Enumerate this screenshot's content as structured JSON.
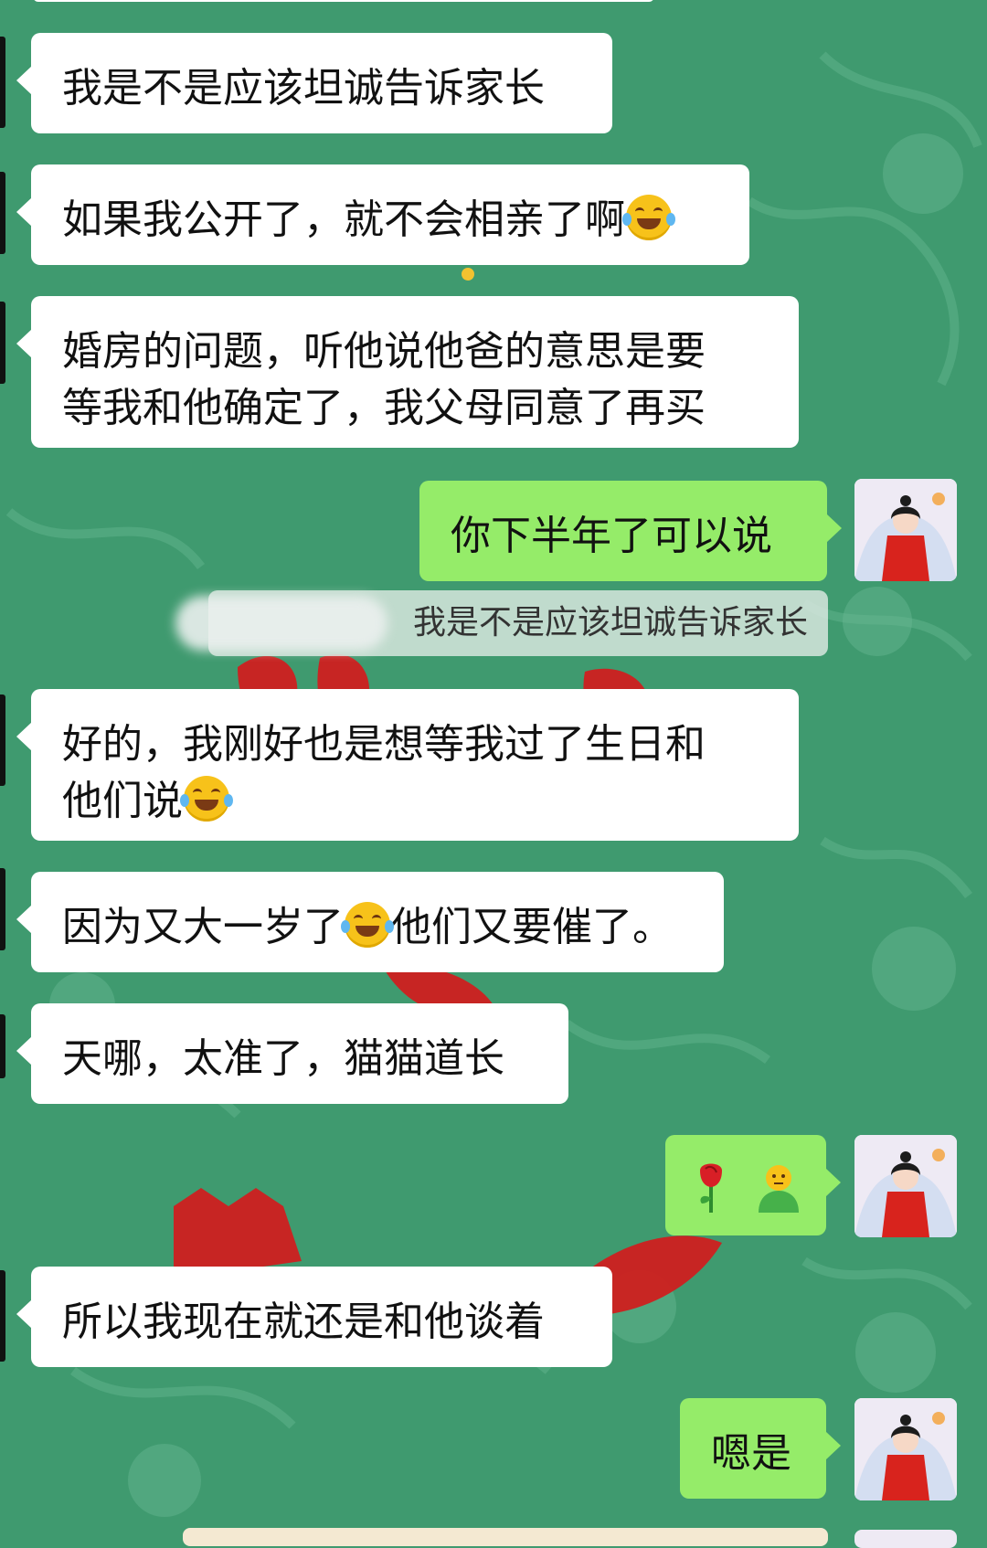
{
  "conversation": {
    "messages": [
      {
        "side": "in",
        "text": "我是不是应该坦诚告诉家长"
      },
      {
        "side": "in",
        "text": "如果我公开了，就不会相亲了啊",
        "trailing_emoji": "tears-of-joy"
      },
      {
        "side": "in",
        "lines": [
          "婚房的问题，听他说他爸的意思是要",
          "等我和他确定了，我父母同意了再买"
        ]
      },
      {
        "side": "out",
        "text": "你下半年了可以说"
      },
      {
        "side": "quote",
        "text": "我是不是应该坦诚告诉家长"
      },
      {
        "side": "in",
        "lines": [
          "好的，我刚好也是想等我过了生日和",
          "他们说"
        ],
        "trailing_emoji": "tears-of-joy"
      },
      {
        "side": "in",
        "text_before": "因为又大一岁了",
        "text_after": "他们又要催了。",
        "inline_emoji": "tears-of-joy"
      },
      {
        "side": "in",
        "text": "天哪，太准了，猫猫道长"
      },
      {
        "side": "out",
        "emojis": [
          "rose",
          "person-pouting"
        ]
      },
      {
        "side": "in",
        "text": "所以我现在就还是和他谈着"
      },
      {
        "side": "out",
        "text": "嗯是"
      }
    ]
  },
  "colors": {
    "background": "#3f9a6f",
    "incoming_bubble": "#ffffff",
    "outgoing_bubble": "#95ec69",
    "quote_bubble": "#d7e6de"
  }
}
